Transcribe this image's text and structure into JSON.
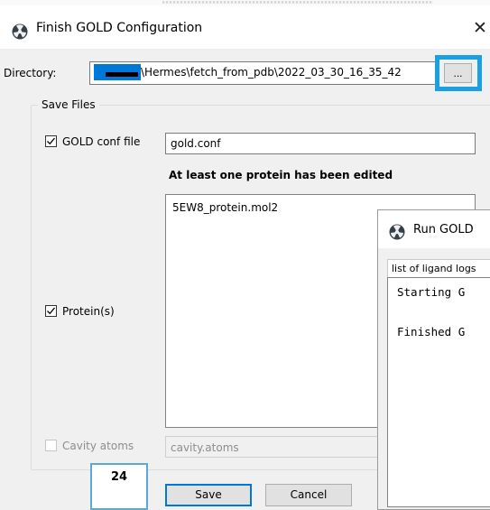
{
  "dialog": {
    "title": "Finish GOLD Configuration",
    "close_glyph": "✕",
    "directory": {
      "label": "Directory:",
      "path": "\\Hermes\\fetch_from_pdb\\2022_03_30_16_35_42",
      "browse_label": "..."
    },
    "save_files": {
      "title": "Save Files",
      "gold_conf": {
        "checkbox_label": "GOLD conf file",
        "checked": true,
        "value": "gold.conf"
      },
      "warning": "At least one protein has been edited",
      "proteins": {
        "checkbox_label": "Protein(s)",
        "checked": true,
        "items": [
          "5EW8_protein.mol2"
        ]
      },
      "cavity": {
        "checkbox_label": "Cavity atoms",
        "checked": false,
        "enabled": false,
        "value": "cavity.atoms"
      }
    },
    "buttons": {
      "save": "Save",
      "cancel": "Cancel"
    }
  },
  "badge": {
    "number": "24"
  },
  "run_window": {
    "title": "Run GOLD",
    "tab_label": "list of ligand logs",
    "log_lines": [
      "Starting G",
      "Finished G"
    ]
  },
  "colors": {
    "accent": "#0078d7",
    "annotation": "#1ba1e2",
    "dialog_bg": "#f0f0f0"
  },
  "icons": {
    "app": "gold-app-icon",
    "close": "close-icon",
    "check": "checkmark-icon"
  }
}
